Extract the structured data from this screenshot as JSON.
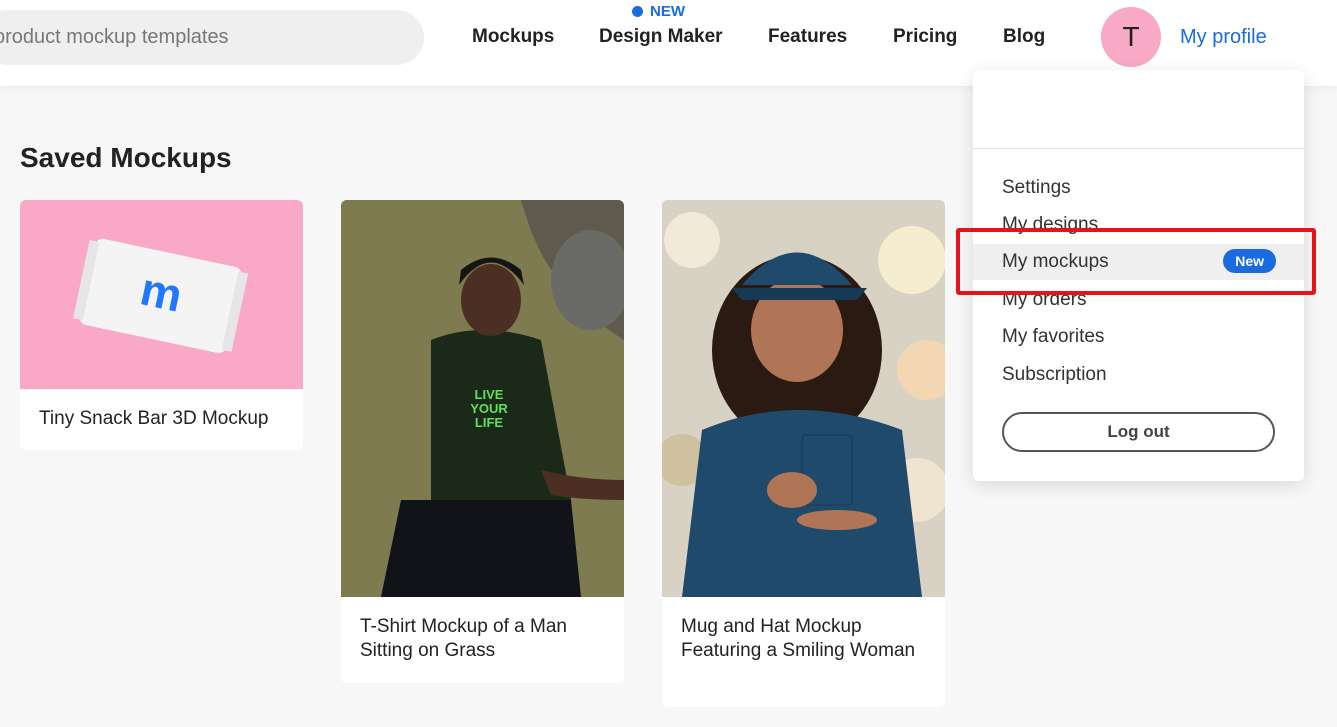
{
  "header": {
    "search_placeholder": "product mockup templates",
    "nav": [
      {
        "label": "Mockups"
      },
      {
        "label": "Design Maker"
      },
      {
        "label": "Features"
      },
      {
        "label": "Pricing"
      },
      {
        "label": "Blog"
      }
    ],
    "new_label": "NEW",
    "avatar_initial": "T",
    "profile_label": "My profile"
  },
  "main": {
    "title": "Saved Mockups",
    "cards": [
      {
        "caption": "Tiny Snack Bar 3D Mockup"
      },
      {
        "caption": "T-Shirt Mockup of a Man Sitting on Grass"
      },
      {
        "caption": "Mug and Hat Mockup Featuring a Smiling Woman"
      }
    ],
    "snack_logo_letter": "m",
    "shirt_print": [
      "LIVE",
      "YOUR",
      "LIFE"
    ]
  },
  "dropdown": {
    "items": [
      {
        "label": "Settings"
      },
      {
        "label": "My designs"
      },
      {
        "label": "My mockups",
        "badge": "New"
      },
      {
        "label": "My orders"
      },
      {
        "label": "My favorites"
      },
      {
        "label": "Subscription"
      }
    ],
    "logout_label": "Log out"
  },
  "colors": {
    "accent": "#1a6be0",
    "avatar_bg": "#f8a9c5",
    "highlight_border": "#e8121b"
  }
}
